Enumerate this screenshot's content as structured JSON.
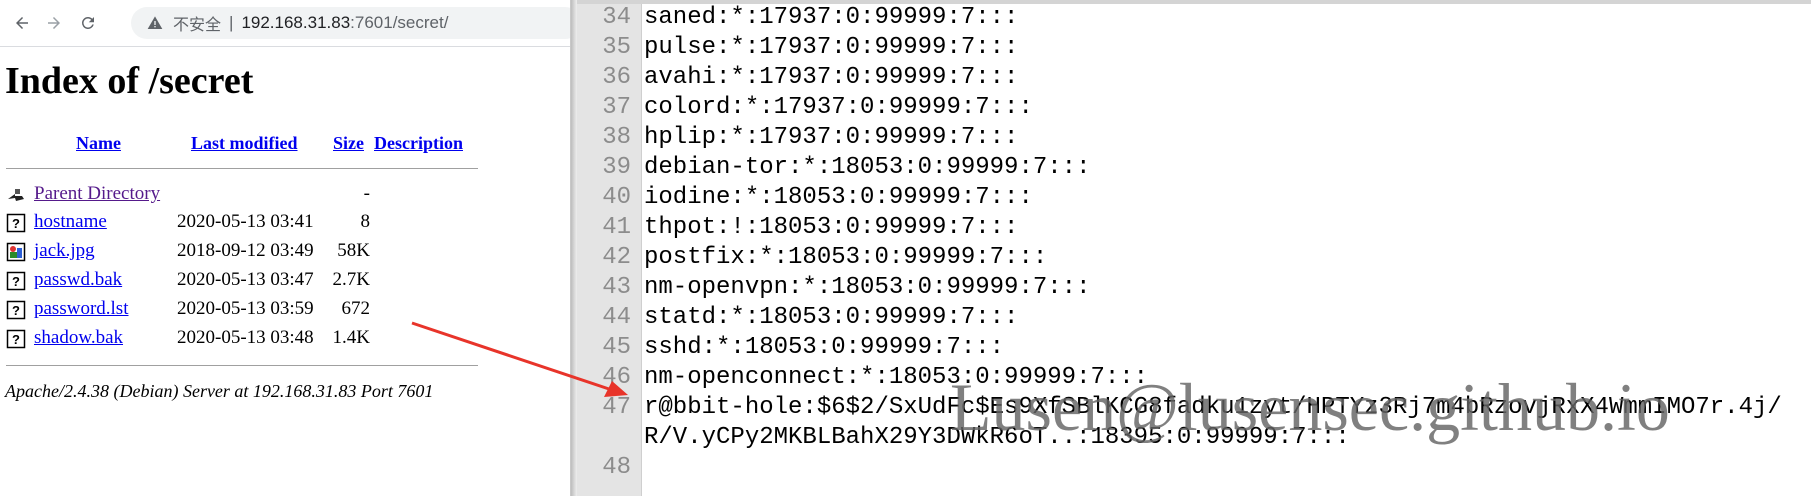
{
  "browser": {
    "address_bar": {
      "security_label": "不安全",
      "separator": "|",
      "host": "192.168.31.83",
      "path": ":7601/secret/"
    },
    "page": {
      "title": "Index of /secret",
      "columns": {
        "name": "Name",
        "last_modified": "Last modified",
        "size": "Size",
        "description": "Description"
      },
      "parent": {
        "name": "Parent Directory",
        "size": "-"
      },
      "files": [
        {
          "name": "hostname",
          "date": "2020-05-13 03:41",
          "size": "8",
          "icon": "unknown-file-icon"
        },
        {
          "name": "jack.jpg",
          "date": "2018-09-12 03:49",
          "size": "58K",
          "icon": "image-file-icon"
        },
        {
          "name": "passwd.bak",
          "date": "2020-05-13 03:47",
          "size": "2.7K",
          "icon": "unknown-file-icon"
        },
        {
          "name": "password.lst",
          "date": "2020-05-13 03:59",
          "size": "672",
          "icon": "unknown-file-icon"
        },
        {
          "name": "shadow.bak",
          "date": "2020-05-13 03:48",
          "size": "1.4K",
          "icon": "unknown-file-icon"
        }
      ],
      "server_signature": "Apache/2.4.38 (Debian) Server at 192.168.31.83 Port 7601"
    }
  },
  "editor": {
    "lines": [
      {
        "num": "34",
        "text": "saned:*:17937:0:99999:7:::"
      },
      {
        "num": "35",
        "text": "pulse:*:17937:0:99999:7:::"
      },
      {
        "num": "36",
        "text": "avahi:*:17937:0:99999:7:::"
      },
      {
        "num": "37",
        "text": "colord:*:17937:0:99999:7:::"
      },
      {
        "num": "38",
        "text": "hplip:*:17937:0:99999:7:::"
      },
      {
        "num": "39",
        "text": "debian-tor:*:18053:0:99999:7:::"
      },
      {
        "num": "40",
        "text": "iodine:*:18053:0:99999:7:::"
      },
      {
        "num": "41",
        "text": "thpot:!:18053:0:99999:7:::"
      },
      {
        "num": "42",
        "text": "postfix:*:18053:0:99999:7:::"
      },
      {
        "num": "43",
        "text": "nm-openvpn:*:18053:0:99999:7:::"
      },
      {
        "num": "44",
        "text": "statd:*:18053:0:99999:7:::"
      },
      {
        "num": "45",
        "text": "sshd:*:18053:0:99999:7:::"
      },
      {
        "num": "46",
        "text": "nm-openconnect:*:18053:0:99999:7:::"
      },
      {
        "num": "47",
        "text": "r@bbit-hole:$6$2/SxUdFc$Es9XfSBlKCG8fadku1zyt/HPTYz3Rj7m4bRzovjRxX4WmmIMO7r.4j/"
      },
      {
        "num": "",
        "text": "R/V.yCPy2MKBLBahX29Y3DWkR6oT..:18395:0:99999:7:::"
      },
      {
        "num": "48",
        "text": ""
      }
    ]
  },
  "overlay": {
    "watermark": "Lusen@lusensec.github.io",
    "arrow_color": "#e8342a"
  }
}
